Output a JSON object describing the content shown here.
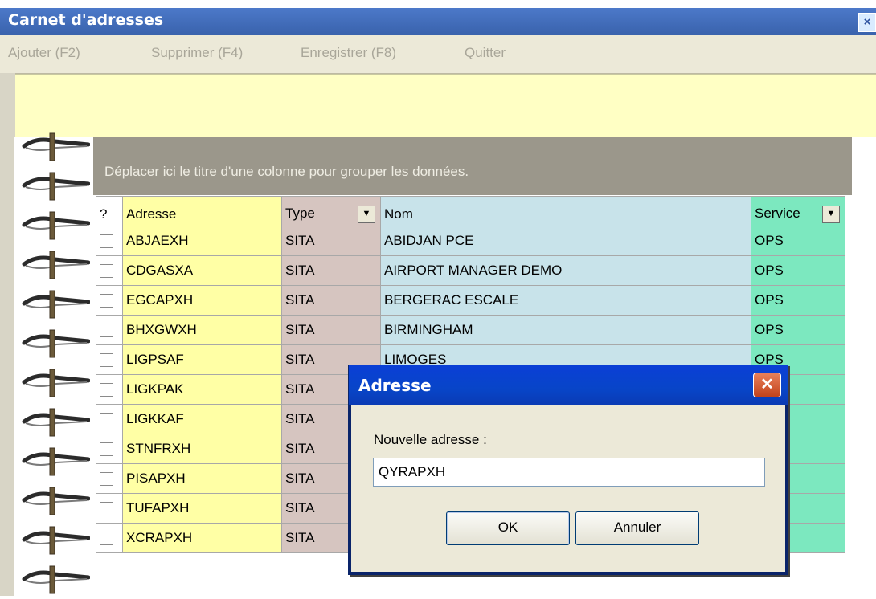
{
  "window": {
    "title": "Carnet d'adresses",
    "close_glyph": "×"
  },
  "menu": [
    "Ajouter (F2)",
    "Supprimer (F4)",
    "Enregistrer (F8)",
    "Quitter"
  ],
  "group_hint": "Déplacer ici le titre d'une colonne pour grouper les données.",
  "grid": {
    "headers": {
      "select": "?",
      "address": "Adresse",
      "type": "Type",
      "name": "Nom",
      "service": "Service"
    },
    "rows": [
      {
        "address": "ABJAEXH",
        "type": "SITA",
        "name": "ABIDJAN PCE",
        "service": "OPS"
      },
      {
        "address": "CDGASXA",
        "type": "SITA",
        "name": "AIRPORT MANAGER  DEMO",
        "service": "OPS"
      },
      {
        "address": "EGCAPXH",
        "type": "SITA",
        "name": "BERGERAC ESCALE",
        "service": "OPS"
      },
      {
        "address": "BHXGWXH",
        "type": "SITA",
        "name": "BIRMINGHAM",
        "service": "OPS"
      },
      {
        "address": "LIGPSAF",
        "type": "SITA",
        "name": "LIMOGES",
        "service": "OPS"
      },
      {
        "address": "LIGKPAK",
        "type": "SITA",
        "name": "",
        "service": ""
      },
      {
        "address": "LIGKKAF",
        "type": "SITA",
        "name": "",
        "service": ""
      },
      {
        "address": "STNFRXH",
        "type": "SITA",
        "name": "",
        "service": ""
      },
      {
        "address": "PISAPXH",
        "type": "SITA",
        "name": "",
        "service": ""
      },
      {
        "address": "TUFAPXH",
        "type": "SITA",
        "name": "",
        "service": ""
      },
      {
        "address": "XCRAPXH",
        "type": "SITA",
        "name": "",
        "service": ""
      }
    ]
  },
  "dialog": {
    "title": "Adresse",
    "close_glyph": "✕",
    "label": "Nouvelle adresse :",
    "value": "QYRAPXH",
    "ok": "OK",
    "cancel": "Annuler"
  },
  "colors": {
    "titlebar": "#3a63ad",
    "address_col": "#ffffa5",
    "type_col": "#d6c5c0",
    "name_col": "#c8e3ea",
    "service_col": "#7ce8bf",
    "dialog_title": "#0845c8"
  }
}
